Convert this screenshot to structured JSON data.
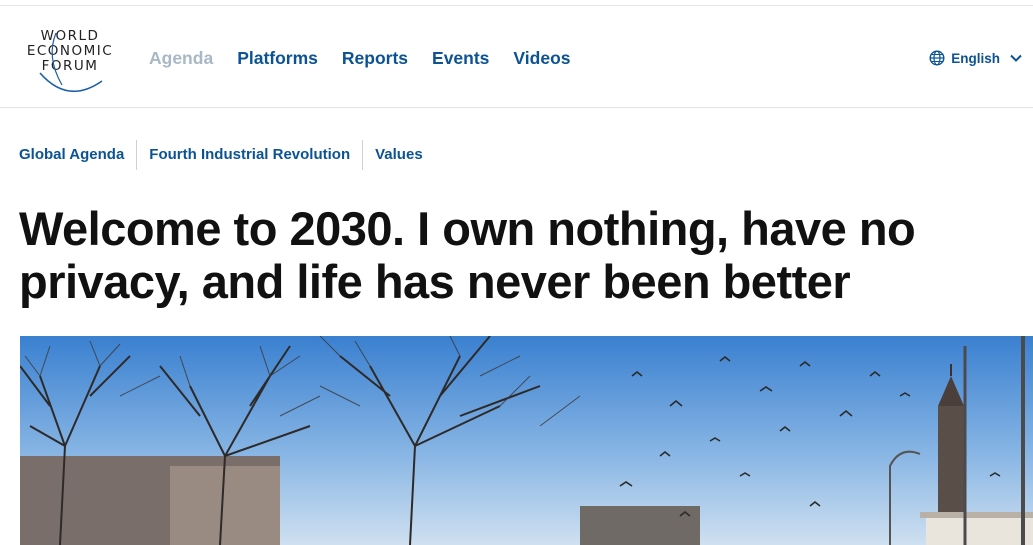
{
  "logo": {
    "line1": "WORLD",
    "line2": "ECONOMIC",
    "line3": "FORUM"
  },
  "nav": [
    {
      "label": "Agenda",
      "active": true
    },
    {
      "label": "Platforms"
    },
    {
      "label": "Reports"
    },
    {
      "label": "Events"
    },
    {
      "label": "Videos"
    }
  ],
  "language": {
    "label": "English"
  },
  "breadcrumbs": [
    {
      "label": "Global Agenda"
    },
    {
      "label": "Fourth Industrial Revolution"
    },
    {
      "label": "Values"
    }
  ],
  "article": {
    "title": "Welcome to 2030. I own nothing, have no privacy, and life has never been better"
  },
  "colors": {
    "link": "#0b5394",
    "muted_nav": "#a9b8c6",
    "sky_top": "#3f86d4",
    "sky_bottom": "#c7dcef"
  },
  "hero_image": {
    "icon": "city-square-with-trees-and-birds-photo"
  }
}
